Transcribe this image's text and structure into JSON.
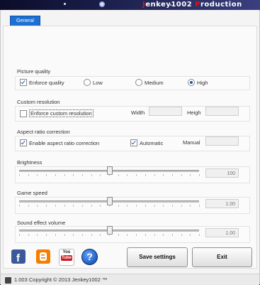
{
  "banner": {
    "prefix": "J",
    "title_rest": "enkey1002 ",
    "title_p": "P",
    "title_tail": "roduction"
  },
  "tabs": [
    {
      "label": "General"
    }
  ],
  "picture_quality": {
    "title": "Picture quality",
    "enforce_label": "Enforce quality",
    "enforce_checked": true,
    "options": [
      {
        "label": "Low",
        "selected": false
      },
      {
        "label": "Medium",
        "selected": false
      },
      {
        "label": "High",
        "selected": true
      }
    ]
  },
  "custom_resolution": {
    "title": "Custom resolution",
    "enforce_label": "Enforce custom resolution",
    "enforce_checked": false,
    "width_label": "Width",
    "width_value": "",
    "height_label": "Heigh",
    "height_value": ""
  },
  "aspect_ratio": {
    "title": "Aspect ratio correction",
    "enable_label": "Enable aspect ratio correction",
    "enable_checked": true,
    "auto_label": "Automatic",
    "auto_checked": true,
    "manual_label": "Manual",
    "manual_value": ""
  },
  "brightness": {
    "title": "Brightness",
    "value": "100",
    "level": 0.5
  },
  "game_speed": {
    "title": "Game speed",
    "value": "1.00",
    "level": 0.5
  },
  "sound_volume": {
    "title": "Sound effect volume",
    "value": "1.00",
    "level": 0.5
  },
  "social": [
    {
      "icon": "facebook-icon"
    },
    {
      "icon": "blogger-icon"
    },
    {
      "icon": "youtube-icon",
      "label": "You Tube"
    },
    {
      "icon": "help-icon",
      "label": "?"
    }
  ],
  "buttons": {
    "save": "Save settings",
    "exit": "Exit"
  },
  "status": {
    "text": "1.003 Copyright © 2013 Jenkey1002 ™"
  }
}
